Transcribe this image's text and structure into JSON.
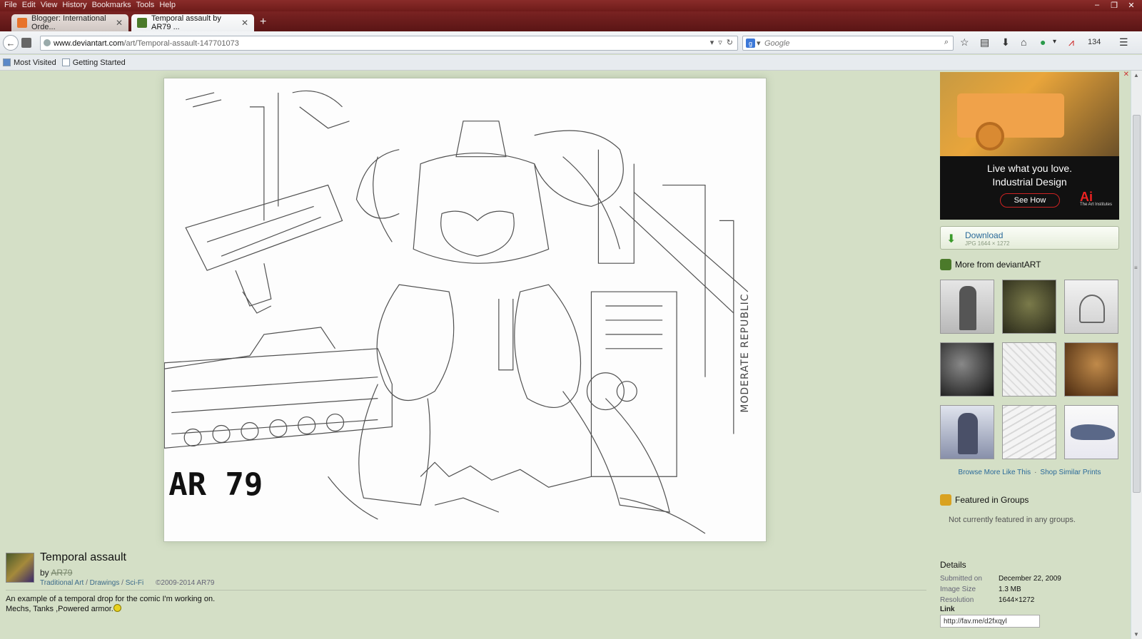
{
  "window": {
    "menu": [
      "File",
      "Edit",
      "View",
      "History",
      "Bookmarks",
      "Tools",
      "Help"
    ],
    "controls": [
      "–",
      "❐",
      "✕"
    ]
  },
  "tabs": [
    {
      "label": "Blogger: International Orde...",
      "active": false,
      "favicon_color": "#e8732a"
    },
    {
      "label": "Temporal assault by AR79 ...",
      "active": true,
      "favicon_color": "#4b7a2a"
    }
  ],
  "navbar": {
    "url_host": "www.deviantart.com",
    "url_path": "/art/Temporal-assault-147701073",
    "search_placeholder": "Google",
    "badge_count": "134"
  },
  "bookmarks": [
    {
      "label": "Most Visited"
    },
    {
      "label": "Getting Started"
    }
  ],
  "artwork": {
    "signature": "AR 79",
    "side_text": "MODERATE REPUBLIC"
  },
  "deviation": {
    "title": "Temporal assault",
    "by_label": "by",
    "author": "AR79",
    "categories": [
      "Traditional Art",
      "Drawings",
      "Sci-Fi"
    ],
    "category_sep": "/",
    "copyright": "©2009-2014 AR79",
    "description_line1": "An example of a temporal drop for the comic I'm working on.",
    "description_line2": "Mechs, Tanks ,Powered armor."
  },
  "ad": {
    "line1": "Live what you love.",
    "line2": "Industrial Design",
    "button": "See How",
    "brand": "Ai",
    "brand_sub": "The Art Institutes",
    "close": "✕"
  },
  "download": {
    "label": "Download",
    "sub": "JPG 1644 × 1272"
  },
  "more": {
    "heading": "More from deviantART",
    "thumb_colors": [
      "#c9c9c9",
      "#5a5a3a",
      "#d8d8d8",
      "#3a3a3a",
      "#e6e6e6",
      "#8a5a2a",
      "#b8bcc8",
      "#e2e2e2",
      "#a8b0c8"
    ],
    "browse_more": "Browse More Like This",
    "dot": "·",
    "shop_prints": "Shop Similar Prints"
  },
  "groups": {
    "heading": "Featured in Groups",
    "none_text": "Not currently featured in any groups."
  },
  "details": {
    "heading": "Details",
    "rows": [
      {
        "key": "Submitted on",
        "value": "December 22, 2009"
      },
      {
        "key": "Image Size",
        "value": "1.3 MB"
      },
      {
        "key": "Resolution",
        "value": "1644×1272"
      }
    ],
    "link_label": "Link",
    "link_value": "http://fav.me/d2fxqyl"
  }
}
